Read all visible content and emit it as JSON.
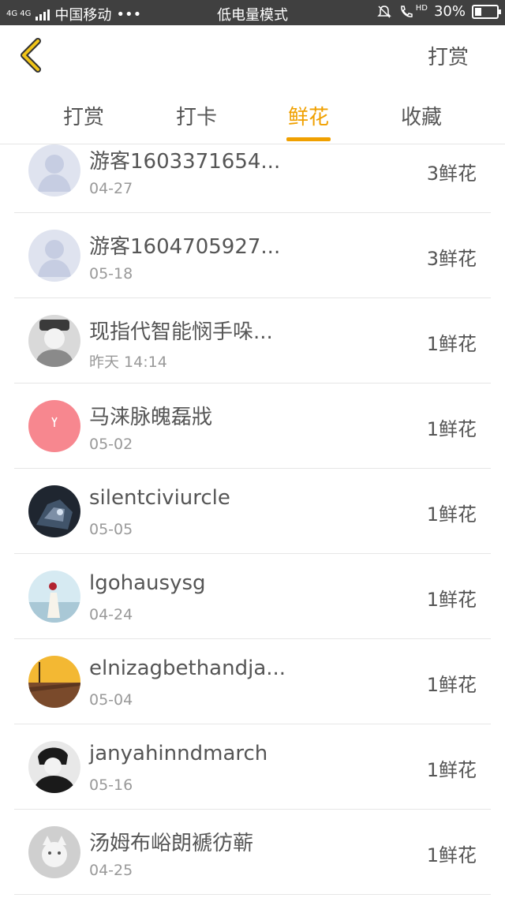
{
  "status_bar": {
    "network": "4G 4G",
    "carrier": "中国移动",
    "dots": "•••",
    "mode": "低电量模式",
    "hd": "HD",
    "battery": "30%",
    "battery_level": 0.3
  },
  "header": {
    "reward_link": "打赏"
  },
  "tabs": [
    {
      "label": "打赏",
      "active": false
    },
    {
      "label": "打卡",
      "active": false
    },
    {
      "label": "鲜花",
      "active": true
    },
    {
      "label": "收藏",
      "active": false
    }
  ],
  "colors": {
    "accent": "#f0a000",
    "status_bar": "#404040"
  },
  "rows": [
    {
      "name": "游客1603371654...",
      "date": "04-27",
      "count": "3鲜花",
      "avatar": "default-user"
    },
    {
      "name": "游客1604705927...",
      "date": "05-18",
      "count": "3鲜花",
      "avatar": "default-user"
    },
    {
      "name": "现指代智能悯手哚...",
      "date": "昨天 14:14",
      "count": "1鲜花",
      "avatar": "photo-person"
    },
    {
      "name": "马涞脉魄磊戕",
      "date": "05-02",
      "count": "1鲜花",
      "avatar": "pink-deer"
    },
    {
      "name": "silentciviurcle",
      "date": "05-05",
      "count": "1鲜花",
      "avatar": "photo-robot"
    },
    {
      "name": "lgohausysg",
      "date": "04-24",
      "count": "1鲜花",
      "avatar": "photo-seaside"
    },
    {
      "name": "elnizagbethandja...",
      "date": "05-04",
      "count": "1鲜花",
      "avatar": "photo-sunset-pier"
    },
    {
      "name": "janyahinndmarch",
      "date": "05-16",
      "count": "1鲜花",
      "avatar": "photo-portrait-bw"
    },
    {
      "name": "汤姆布峪朗褫彷蕲",
      "date": "04-25",
      "count": "1鲜花",
      "avatar": "photo-cat"
    }
  ]
}
